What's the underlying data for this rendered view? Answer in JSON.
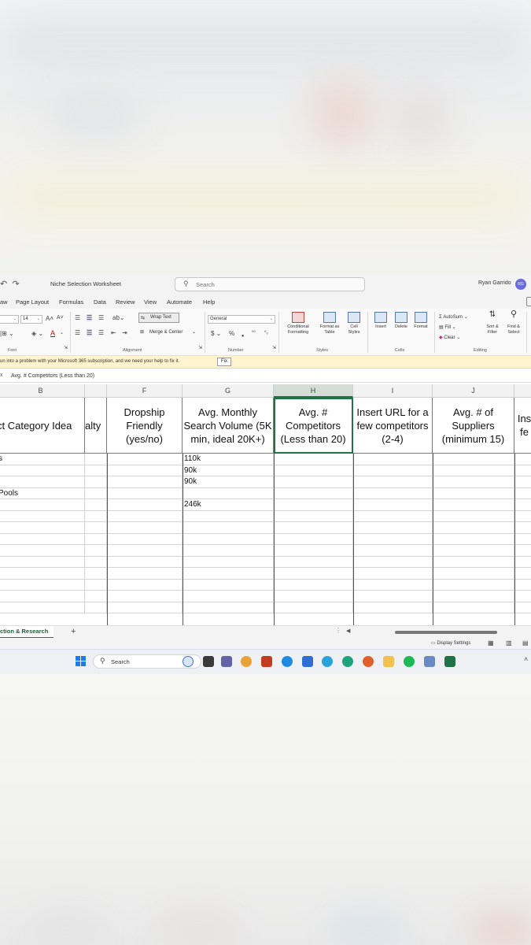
{
  "window": {
    "document_title": "Niche Selection Worksheet",
    "search_placeholder": "Search",
    "user_name": "Ryan Garrido",
    "user_initials": "RG"
  },
  "menu_tabs": [
    "aw",
    "Page Layout",
    "Formulas",
    "Data",
    "Review",
    "View",
    "Automate",
    "Help"
  ],
  "ribbon": {
    "font_size": "14",
    "font_group_label": "Font",
    "alignment_group_label": "Alignment",
    "wrap_text_label": "Wrap Text",
    "merge_center_label": "Merge & Center",
    "number_format": "General",
    "number_group_label": "Number",
    "conditional_formatting_label": [
      "Conditional",
      "Formatting"
    ],
    "format_as_table_label": [
      "Format as",
      "Table"
    ],
    "cell_styles_label": [
      "Cell",
      "Styles"
    ],
    "styles_group_label": "Styles",
    "insert_label": "Insert",
    "delete_label": "Delete",
    "format_label": "Format",
    "cells_group_label": "Cells",
    "autosum_label": "AutoSum",
    "fill_label": "Fill",
    "clear_label": "Clear",
    "sort_filter_label": [
      "Sort &",
      "Filter"
    ],
    "find_select_label": [
      "Find &",
      "Select"
    ],
    "editing_group_label": "Editing"
  },
  "message_bar": {
    "text": "un into a problem with your Microsoft 365 subscription, and we need your help to fix it.",
    "fix_label": "Fix"
  },
  "formula_bar": {
    "content": "Avg. # Competitors (Less than 20)"
  },
  "columns": [
    "B",
    "",
    "F",
    "G",
    "H",
    "I",
    "J",
    ""
  ],
  "header_row": [
    "ct Category Idea",
    "alty",
    "Dropship Friendly (yes/no)",
    "Avg. Monthly Search Volume (5K min, ideal 20K+)",
    "Avg. # Competitors (Less than 20)",
    "Insert URL for a few competitors (2-4)",
    "Avg. # of Suppliers (minimum 15)",
    "Ins fe"
  ],
  "data_rows": [
    [
      "s",
      "",
      "",
      "110k",
      "",
      "",
      "",
      ""
    ],
    [
      "",
      "",
      "",
      "90k",
      "",
      "",
      "",
      ""
    ],
    [
      "",
      "",
      "",
      "90k",
      "",
      "",
      "",
      ""
    ],
    [
      "Pools",
      "",
      "",
      "",
      "",
      "",
      "",
      ""
    ],
    [
      "",
      "",
      "",
      "246k",
      "",
      "",
      "",
      ""
    ],
    [
      "",
      "",
      "",
      "",
      "",
      "",
      "",
      ""
    ],
    [
      "",
      "",
      "",
      "",
      "",
      "",
      "",
      ""
    ],
    [
      "",
      "",
      "",
      "",
      "",
      "",
      "",
      ""
    ],
    [
      "",
      "",
      "",
      "",
      "",
      "",
      "",
      ""
    ],
    [
      "",
      "",
      "",
      "",
      "",
      "",
      "",
      ""
    ],
    [
      "",
      "",
      "",
      "",
      "",
      "",
      "",
      ""
    ],
    [
      "",
      "",
      "",
      "",
      "",
      "",
      "",
      ""
    ],
    [
      "",
      "",
      "",
      "",
      "",
      "",
      "",
      ""
    ],
    [
      "",
      "",
      "",
      "",
      "",
      "",
      "",
      ""
    ]
  ],
  "sheet_tab": "ction & Research",
  "status_bar": {
    "display_settings": "Display Settings"
  },
  "taskbar": {
    "search_placeholder": "Search"
  },
  "colors": {
    "excel_green": "#217346",
    "message_bar": "#fff4ce",
    "avatar": "#6b6be0",
    "windows_blue": "#1f7be6"
  }
}
